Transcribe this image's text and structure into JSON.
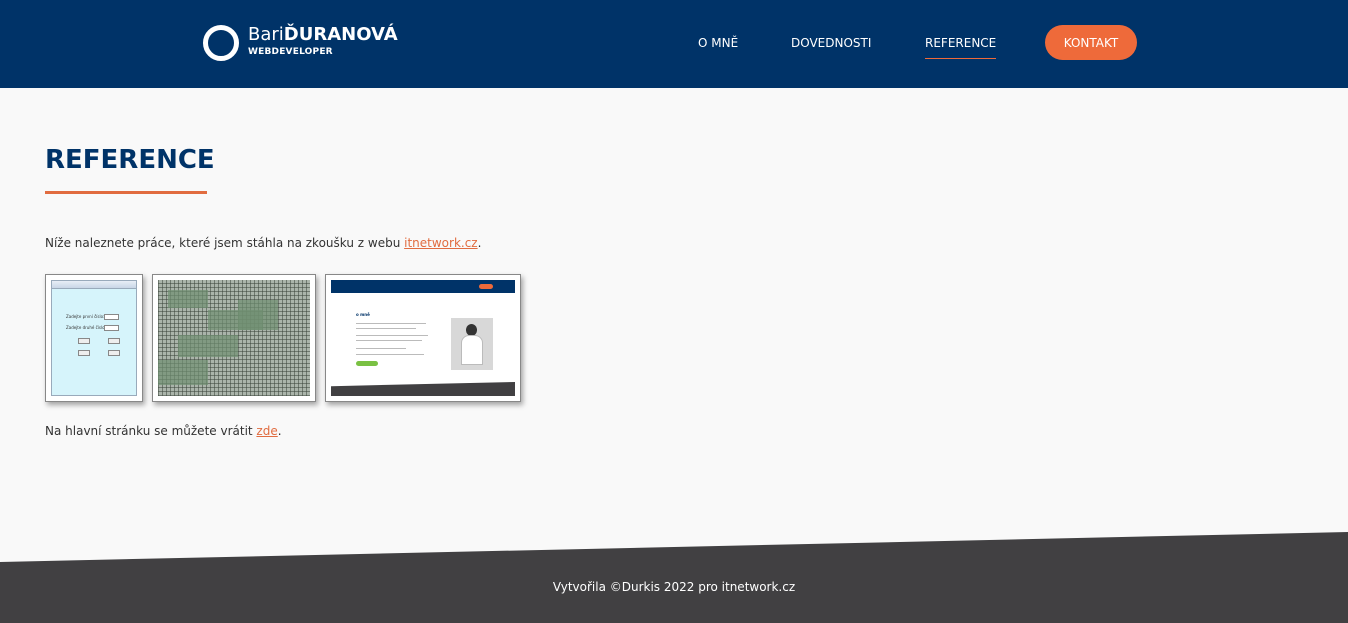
{
  "header": {
    "logo": {
      "name_light": "Bari",
      "name_bold": "ĎURANOVÁ",
      "subtitle": "WEBDEVELOPER",
      "icon": "ring-logo-icon"
    },
    "nav": {
      "about": "O MNĚ",
      "skills": "DOVEDNOSTI",
      "references": "REFERENCE",
      "contact": "KONTAKT",
      "active": "REFERENCE"
    }
  },
  "main": {
    "title": "REFERENCE",
    "intro_text": "Níže naleznete práce, které jsem stáhla na zkoušku z webu ",
    "intro_link": "itnetwork.cz",
    "intro_end": ".",
    "back_text": "Na hlavní stránku se můžete vrátit ",
    "back_link": "zde",
    "back_end": ".",
    "thumbnails": [
      {
        "kind": "calculator-app-screenshot",
        "labels": [
          "Zadejte první číslo:",
          "Zadejte druhé číslo:"
        ],
        "values": [
          "10",
          "20"
        ]
      },
      {
        "kind": "game-map-screenshot"
      },
      {
        "kind": "website-screenshot",
        "heading": "o mně"
      }
    ]
  },
  "footer": {
    "text": "Vytvořila ©Durkis 2022 pro itnetwork.cz"
  },
  "colors": {
    "header_bg": "#003368",
    "accent": "#ee6a3a",
    "footer_bg": "#414042",
    "page_bg": "#f9f9f9"
  }
}
